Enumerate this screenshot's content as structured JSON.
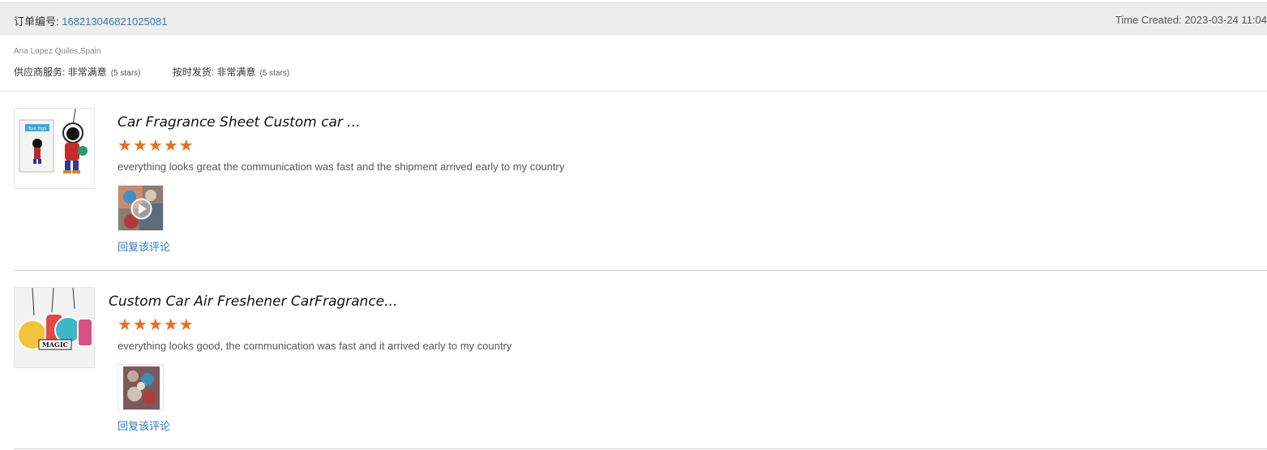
{
  "order": {
    "label": "订单编号: ",
    "number": "168213046821025081",
    "time_created": "Time Created: 2023-03-24 11:04"
  },
  "buyer": {
    "name_country": "Ana Lopez Quiles,Spain"
  },
  "ratings": [
    {
      "label": "供应商服务: ",
      "value": "非常满意",
      "stars_text": "(5 stars)"
    },
    {
      "label": "按时发货: ",
      "value": "非常满意",
      "stars_text": "(5 stars)"
    }
  ],
  "reviews": [
    {
      "product_title": "Car Fragrance Sheet Custom car ...",
      "stars": "★★★★★",
      "rating": 5,
      "text": "everything looks great the communication was fast and the shipment arrived early to my country",
      "reply_label": "回复该评论",
      "thumb_logo_text": "Your logo",
      "photo_icon": "play-icon"
    },
    {
      "product_title": "Custom Car Air Freshener CarFragrance...",
      "stars": "★★★★★",
      "rating": 5,
      "text": "everything looks good, the communication was fast and it arrived early to my country",
      "reply_label": "回复该评论",
      "thumb_logo_text": "MAGIC"
    }
  ],
  "colors": {
    "star": "#f26a1b",
    "link": "#2a7fc4",
    "header_bg": "#ededed"
  }
}
